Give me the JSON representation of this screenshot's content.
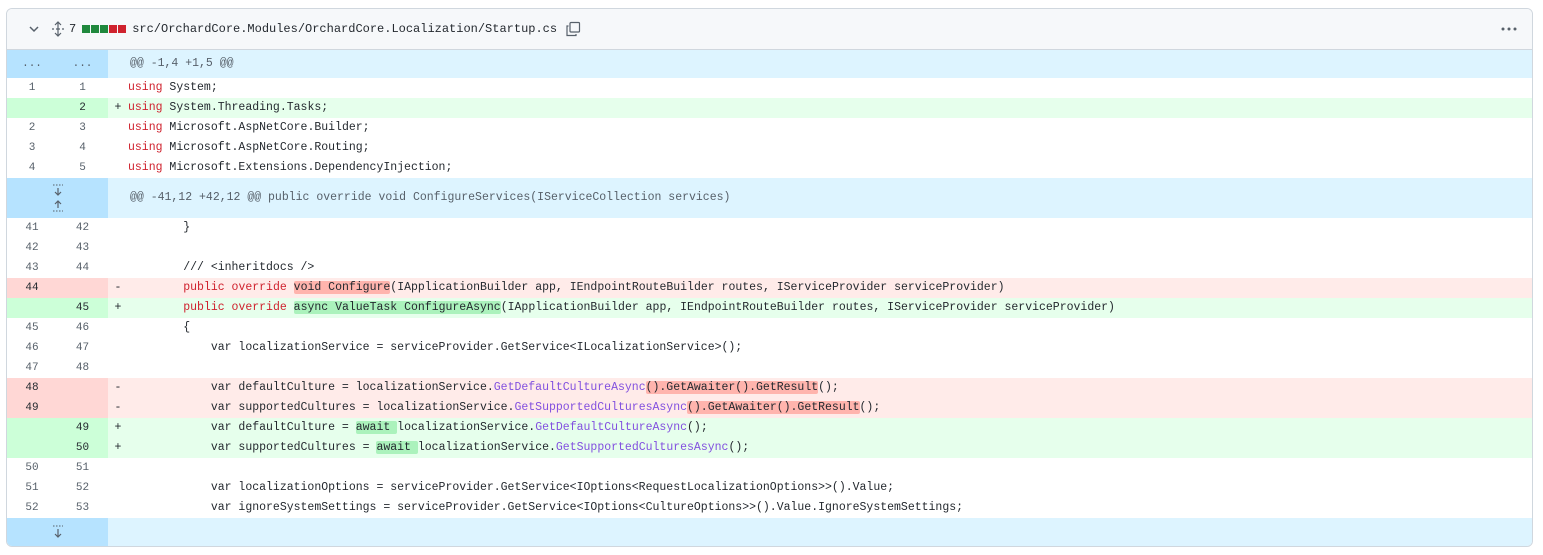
{
  "file_header": {
    "changes_count": "7",
    "file_path": "src/OrchardCore.Modules/OrchardCore.Localization/Startup.cs",
    "diffstat_blocks": [
      "#1f883d",
      "#1f883d",
      "#1f883d",
      "#cf222e",
      "#cf222e"
    ],
    "icons": [
      "chevron-down-icon",
      "unfold-icon",
      "copy-icon",
      "kebab-horizontal-icon"
    ]
  },
  "hunks": {
    "h1": {
      "left": "...",
      "right": "...",
      "text": "@@ -1,4 +1,5 @@"
    },
    "h2": {
      "text": "@@ -41,12 +42,12 @@ public override void ConfigureServices(IServiceCollection services)"
    }
  },
  "lines": [
    {
      "l": "1",
      "r": "1",
      "s": "",
      "t": [
        [
          "using",
          "kw"
        ],
        [
          " System;",
          ""
        ]
      ]
    },
    {
      "l": "",
      "r": "2",
      "s": "+",
      "t": [
        [
          "using",
          "kw"
        ],
        [
          " System.Threading.Tasks;",
          ""
        ]
      ]
    },
    {
      "l": "2",
      "r": "3",
      "s": "",
      "t": [
        [
          "using",
          "kw"
        ],
        [
          " Microsoft.AspNetCore.Builder;",
          ""
        ]
      ]
    },
    {
      "l": "3",
      "r": "4",
      "s": "",
      "t": [
        [
          "using",
          "kw"
        ],
        [
          " Microsoft.AspNetCore.Routing;",
          ""
        ]
      ]
    },
    {
      "l": "4",
      "r": "5",
      "s": "",
      "t": [
        [
          "using",
          "kw"
        ],
        [
          " Microsoft.Extensions.DependencyInjection;",
          ""
        ]
      ]
    },
    {
      "l": "41",
      "r": "42",
      "s": "",
      "t": [
        [
          "        }",
          ""
        ]
      ]
    },
    {
      "l": "42",
      "r": "43",
      "s": "",
      "t": [
        [
          "",
          ""
        ]
      ]
    },
    {
      "l": "43",
      "r": "44",
      "s": "",
      "t": [
        [
          "        /// <inheritdocs />",
          ""
        ]
      ]
    },
    {
      "l": "44",
      "r": "",
      "s": "-",
      "t": [
        [
          "        ",
          ""
        ],
        [
          "public",
          "kw"
        ],
        [
          " ",
          ""
        ],
        [
          "override",
          "kw"
        ],
        [
          " ",
          ""
        ],
        [
          "void Configure",
          "hl-del"
        ],
        [
          "(IApplicationBuilder app, IEndpointRouteBuilder routes, IServiceProvider serviceProvider)",
          ""
        ]
      ]
    },
    {
      "l": "",
      "r": "45",
      "s": "+",
      "t": [
        [
          "        ",
          ""
        ],
        [
          "public",
          "kw"
        ],
        [
          " ",
          ""
        ],
        [
          "override",
          "kw"
        ],
        [
          " ",
          ""
        ],
        [
          "async ValueTask ConfigureAsync",
          "hl-add"
        ],
        [
          "(IApplicationBuilder app, IEndpointRouteBuilder routes, IServiceProvider serviceProvider)",
          ""
        ]
      ]
    },
    {
      "l": "45",
      "r": "46",
      "s": "",
      "t": [
        [
          "        {",
          ""
        ]
      ]
    },
    {
      "l": "46",
      "r": "47",
      "s": "",
      "t": [
        [
          "            var localizationService = serviceProvider.GetService<ILocalizationService>();",
          ""
        ]
      ]
    },
    {
      "l": "47",
      "r": "48",
      "s": "",
      "t": [
        [
          "",
          ""
        ]
      ]
    },
    {
      "l": "48",
      "r": "",
      "s": "-",
      "t": [
        [
          "            var defaultCulture = localizationService.",
          ""
        ],
        [
          "GetDefaultCultureAsync",
          "fn"
        ],
        [
          "().GetAwaiter().GetResult",
          "hl-del"
        ],
        [
          "();",
          ""
        ]
      ]
    },
    {
      "l": "49",
      "r": "",
      "s": "-",
      "t": [
        [
          "            var supportedCultures = localizationService.",
          ""
        ],
        [
          "GetSupportedCulturesAsync",
          "fn"
        ],
        [
          "().GetAwaiter().GetResult",
          "hl-del"
        ],
        [
          "();",
          ""
        ]
      ]
    },
    {
      "l": "",
      "r": "49",
      "s": "+",
      "t": [
        [
          "            var defaultCulture = ",
          ""
        ],
        [
          "await ",
          "hl-add"
        ],
        [
          "localizationService.",
          ""
        ],
        [
          "GetDefaultCultureAsync",
          "fn"
        ],
        [
          "();",
          ""
        ]
      ]
    },
    {
      "l": "",
      "r": "50",
      "s": "+",
      "t": [
        [
          "            var supportedCultures = ",
          ""
        ],
        [
          "await ",
          "hl-add"
        ],
        [
          "localizationService.",
          ""
        ],
        [
          "GetSupportedCulturesAsync",
          "fn"
        ],
        [
          "();",
          ""
        ]
      ]
    },
    {
      "l": "50",
      "r": "51",
      "s": "",
      "t": [
        [
          "",
          ""
        ]
      ]
    },
    {
      "l": "51",
      "r": "52",
      "s": "",
      "t": [
        [
          "            var localizationOptions = serviceProvider.GetService<IOptions<RequestLocalizationOptions>>().Value;",
          ""
        ]
      ]
    },
    {
      "l": "52",
      "r": "53",
      "s": "",
      "t": [
        [
          "            var ignoreSystemSettings = serviceProvider.GetService<IOptions<CultureOptions>>().Value.IgnoreSystemSettings;",
          ""
        ]
      ]
    }
  ]
}
